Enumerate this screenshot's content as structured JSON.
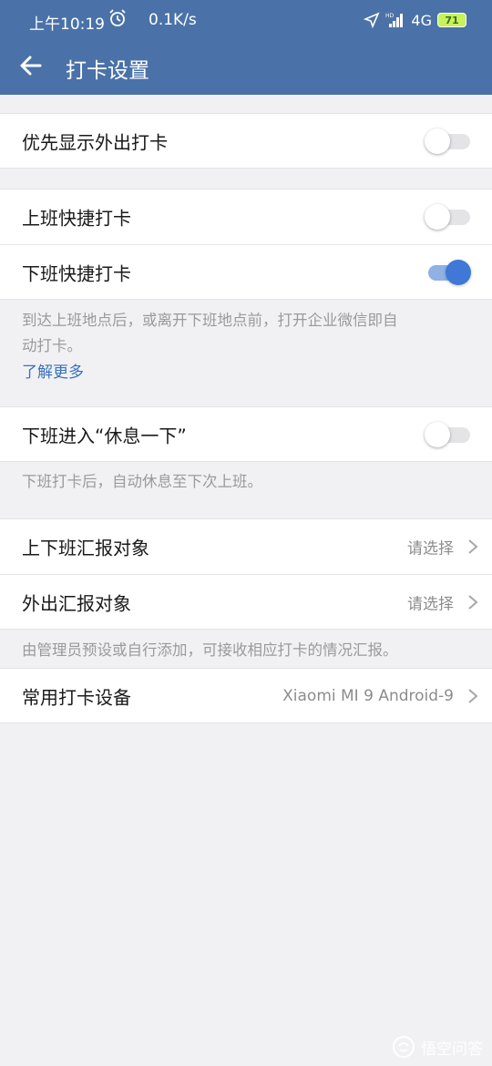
{
  "status_bar": {
    "time": "上午10:19",
    "speed": "0.1K/s",
    "network": "4G",
    "battery": "71"
  },
  "header": {
    "title": "打卡设置"
  },
  "settings": {
    "show_outing": {
      "label": "优先显示外出打卡",
      "on": false
    },
    "quick_in": {
      "label": "上班快捷打卡",
      "on": false
    },
    "quick_out": {
      "label": "下班快捷打卡",
      "on": true
    },
    "quick_hint_line1": "到达上班地点后，或离开下班地点前，打开企业微信即自",
    "quick_hint_line2": "动打卡。",
    "learn_more": "了解更多",
    "rest": {
      "label": "下班进入“休息一下”",
      "on": false
    },
    "rest_hint": "下班打卡后，自动休息至下次上班。",
    "report_commute": {
      "label": "上下班汇报对象",
      "value": "请选择"
    },
    "report_outing": {
      "label": "外出汇报对象",
      "value": "请选择"
    },
    "report_hint": "由管理员预设或自行添加，可接收相应打卡的情况汇报。",
    "device": {
      "label": "常用打卡设备",
      "value": "Xiaomi MI 9 Android-9"
    }
  },
  "watermark": {
    "text": "悟空问答"
  },
  "colors": {
    "header": "#4a72a8",
    "accent": "#3f78d6",
    "background": "#f1f1f4"
  }
}
